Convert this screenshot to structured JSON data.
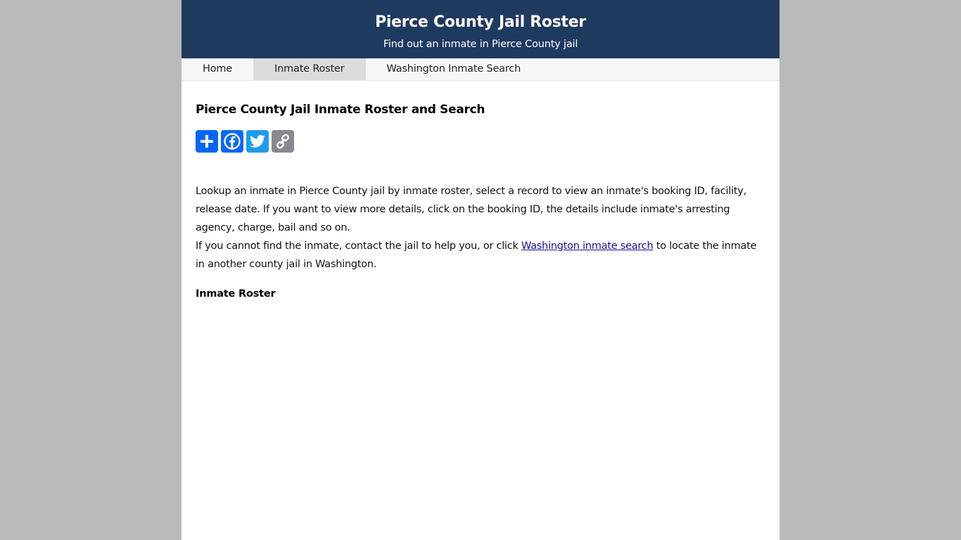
{
  "header": {
    "title": "Pierce County Jail Roster",
    "subtitle": "Find out an inmate in Pierce County jail"
  },
  "nav": {
    "items": [
      {
        "label": "Home",
        "active": false
      },
      {
        "label": "Inmate Roster",
        "active": true
      },
      {
        "label": "Washington Inmate Search",
        "active": false
      }
    ]
  },
  "main": {
    "title": "Pierce County Jail Inmate Roster and Search",
    "share": [
      {
        "name": "share-add",
        "icon": "plus-icon",
        "color": "#0166ff"
      },
      {
        "name": "share-facebook",
        "icon": "facebook-icon",
        "color": "#0866ff"
      },
      {
        "name": "share-twitter",
        "icon": "twitter-icon",
        "color": "#1d9bf0"
      },
      {
        "name": "share-copy-link",
        "icon": "link-icon",
        "color": "#888990"
      }
    ],
    "intro_line1": "Lookup an inmate in Pierce County jail by inmate roster, select a record to view an inmate's booking ID, facility, release date. If you want to view more details, click on the booking ID, the details include inmate's arresting agency, charge, bail and so on.",
    "intro_line2_before": "If you cannot find the inmate, contact the jail to help you, or click ",
    "intro_link": "Washington inmate search",
    "intro_line2_after": " to locate the inmate in another county jail in Washington.",
    "section_title": "Inmate Roster"
  },
  "colors": {
    "header_bg": "#1f3a5f",
    "page_bg": "#b9b9b9",
    "link": "#1a0dab"
  }
}
